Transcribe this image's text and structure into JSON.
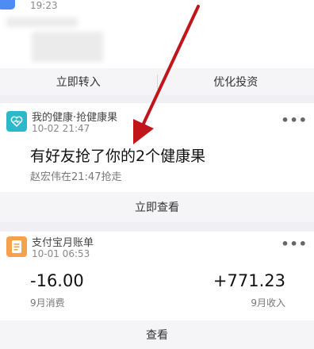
{
  "top_card": {
    "time": "19:23",
    "actions": [
      "立即转入",
      "优化投资"
    ]
  },
  "health_card": {
    "app_name": "我的健康·抢健康果",
    "date": "10-02 21:47",
    "headline": "有好友抢了你的2个健康果",
    "detail": "赵宏伟在21:47抢走",
    "action": "立即查看",
    "icon": "heart-icon",
    "accent": "#2bb8c9"
  },
  "bill_card": {
    "app_name": "支付宝月账单",
    "date": "10-01 06:53",
    "spend_amount": "-16.00",
    "spend_label": "9月消费",
    "income_amount": "+771.23",
    "income_label": "9月收入",
    "action": "查看",
    "icon": "bill-icon",
    "accent": "#f7a14a"
  },
  "more_label": "•••",
  "arrow_color": "#c0161b"
}
